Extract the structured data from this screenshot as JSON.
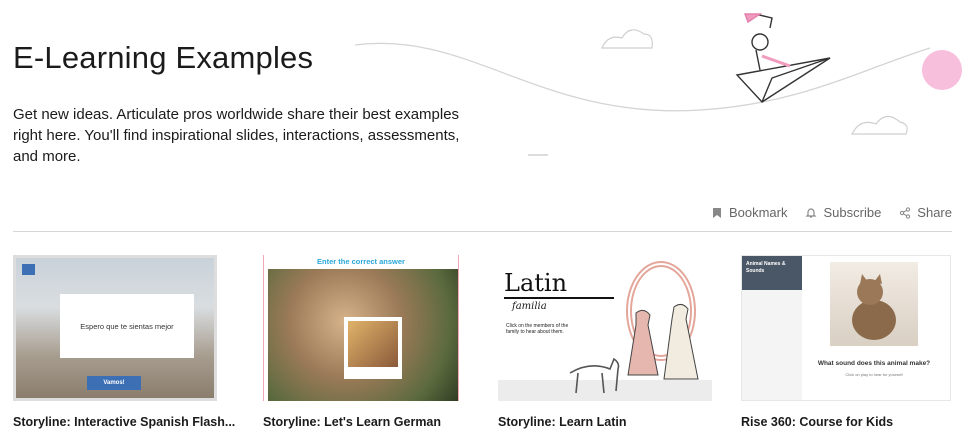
{
  "header": {
    "title": "E-Learning Examples",
    "description": "Get new ideas. Articulate pros worldwide share their best examples right here. You'll find inspirational slides, interactions, assessments, and more."
  },
  "actions": {
    "bookmark": "Bookmark",
    "subscribe": "Subscribe",
    "share": "Share"
  },
  "colors": {
    "accent_blue": "#3d6fb5",
    "pink": "#f7b8d8",
    "divider": "#d6d6d6",
    "muted_text": "#666666"
  },
  "cards": [
    {
      "title": "Storyline: Interactive Spanish Flash...",
      "thumb_text": "Espero que te sientas mejor",
      "button_text": "Vamos!"
    },
    {
      "title": "Storyline: Let's Learn German",
      "thumb_text": "Enter the correct answer"
    },
    {
      "title": "Storyline: Learn Latin",
      "thumb_heading": "Latin",
      "thumb_subheading": "familia",
      "thumb_text": "Click on the members of the family to hear about them."
    },
    {
      "title": "Rise 360: Course for Kids",
      "thumb_sidebar": "Animal Names & Sounds",
      "thumb_text": "What sound does this animal make?",
      "thumb_hint": "Click on play to hear for yourself"
    }
  ]
}
